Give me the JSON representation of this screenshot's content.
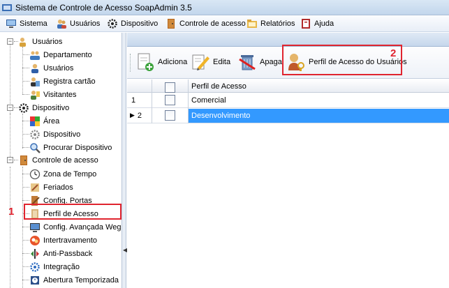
{
  "window": {
    "title": "Sistema de Controle de Acesso SoapAdmin 3.5"
  },
  "menu": [
    {
      "label": "Sistema",
      "icon": "computer-icon"
    },
    {
      "label": "Usuários",
      "icon": "users-icon"
    },
    {
      "label": "Dispositivo",
      "icon": "gear-icon"
    },
    {
      "label": "Controle de acesso",
      "icon": "door-icon"
    },
    {
      "label": "Relatórios",
      "icon": "folder-icon"
    },
    {
      "label": "Ajuda",
      "icon": "help-book-icon"
    }
  ],
  "tree": {
    "groups": [
      {
        "label": "Usuários",
        "children": [
          "Departamento",
          "Usuários",
          "Registra cartão",
          "Visitantes"
        ]
      },
      {
        "label": "Dispositivo",
        "children": [
          "Área",
          "Dispositivo",
          "Procurar Dispositivo"
        ]
      },
      {
        "label": "Controle de acesso",
        "children": [
          "Zona de Tempo",
          "Feriados",
          "Config. Portas",
          "Perfil de Acesso",
          "Config. Avançada Wega",
          "Intertravamento",
          "Anti-Passback",
          "Integração",
          "Abertura Temporizada"
        ]
      }
    ]
  },
  "toolbar": {
    "add_label": "Adiciona",
    "edit_label": "Edita",
    "delete_label": "Apaga",
    "profile_label": "Perfil de Acesso do Usuários"
  },
  "grid": {
    "column_header": "Perfil de Acesso",
    "rows": [
      {
        "index": "1",
        "value": "Comercial",
        "selected": false
      },
      {
        "index": "2",
        "value": "Desenvolvimento",
        "selected": true
      }
    ]
  },
  "annotations": {
    "callout_1": "1",
    "callout_2": "2"
  },
  "colors": {
    "highlight": "#3399ff",
    "callout": "#e0242f"
  }
}
